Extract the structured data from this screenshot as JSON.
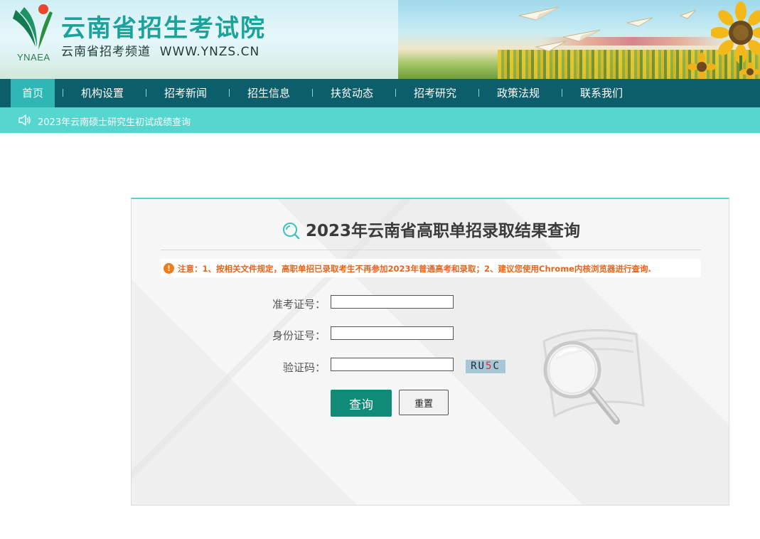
{
  "header": {
    "logo_text": "YNAEA",
    "site_title": "云南省招生考试院",
    "site_subtitle": "云南省招考频道  WWW.YNZS.CN"
  },
  "nav": {
    "items": [
      {
        "label": "首页",
        "active": true
      },
      {
        "label": "机构设置",
        "active": false
      },
      {
        "label": "招考新闻",
        "active": false
      },
      {
        "label": "招生信息",
        "active": false
      },
      {
        "label": "扶贫动态",
        "active": false
      },
      {
        "label": "招考研究",
        "active": false
      },
      {
        "label": "政策法规",
        "active": false
      },
      {
        "label": "联系我们",
        "active": false
      }
    ]
  },
  "notice": {
    "text": "2023年云南硕士研究生初试成绩查询",
    "icon": "speaker-icon"
  },
  "panel": {
    "title": "2023年云南省高职单招录取结果查询",
    "warning_icon": "!",
    "warning": "注意：1、按相关文件规定，高职单招已录取考生不再参加2023年普通高考和录取；2、建议您使用Chrome内核浏览器进行查询.",
    "fields": {
      "exam_no_label": "准考证号：",
      "exam_no_value": "",
      "id_no_label": "身份证号：",
      "id_no_value": "",
      "captcha_label": "验证码：",
      "captcha_value": ""
    },
    "captcha": {
      "part1": "RU",
      "part2": "5",
      "part3": "C"
    },
    "buttons": {
      "query": "查询",
      "reset": "重置"
    }
  },
  "colors": {
    "nav_bg": "#0d5e6b",
    "nav_active": "#2fb7b5",
    "notice_bg": "#57d6cf",
    "query_button": "#0f8b78",
    "warning_text": "#e8641a",
    "title_teal": "#1aa39a"
  }
}
